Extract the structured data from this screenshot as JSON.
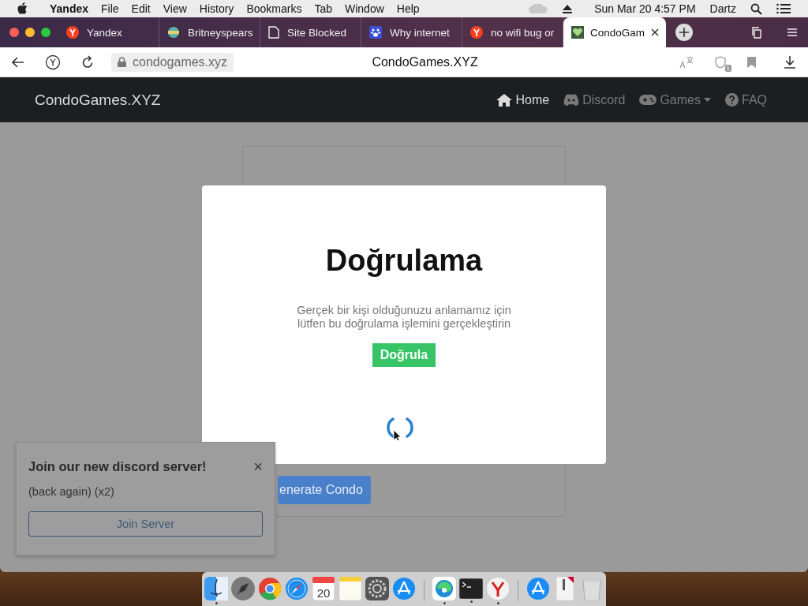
{
  "menubar": {
    "app": "Yandex",
    "menus": [
      "File",
      "Edit",
      "View",
      "History",
      "Bookmarks",
      "Tab",
      "Window",
      "Help"
    ],
    "clock": "Sun Mar 20  4:57 PM",
    "user": "Dartz"
  },
  "tabs": [
    {
      "title": "Yandex",
      "kind": "yandex",
      "selected": false
    },
    {
      "title": "Britneyspears",
      "kind": "globe",
      "selected": false
    },
    {
      "title": "Site Blocked",
      "kind": "page",
      "selected": false
    },
    {
      "title": "Why internet",
      "kind": "paw",
      "selected": false
    },
    {
      "title": "no wifi bug or",
      "kind": "yandex",
      "selected": false
    },
    {
      "title": "CondoGam",
      "kind": "game",
      "selected": true
    }
  ],
  "address_bar": {
    "url": "condogames.xyz",
    "page_title": "CondoGames.XYZ",
    "notification_count": "1"
  },
  "navbar": {
    "brand": "CondoGames.XYZ",
    "links": [
      {
        "label": "Home",
        "kind": "home",
        "selected": true,
        "dropdown": false
      },
      {
        "label": "Discord",
        "kind": "discord",
        "selected": false,
        "dropdown": false
      },
      {
        "label": "Games",
        "kind": "gamepad",
        "selected": false,
        "dropdown": true
      },
      {
        "label": "FAQ",
        "kind": "question",
        "selected": false,
        "dropdown": false
      }
    ]
  },
  "card": {
    "button": "enerate Condo"
  },
  "modal": {
    "title": "Doğrulama",
    "text": "Gerçek bir kişi olduğunuzu anlamamız için\nlütfen bu doğrulama işlemini gerçekleştirin",
    "button": "Doğrula"
  },
  "popup": {
    "title": "Join our new discord server!",
    "close": "×",
    "text": "(back again) (x2)",
    "button": "Join Server"
  },
  "dock": [
    {
      "kind": "finder",
      "running": true
    },
    {
      "kind": "rocket",
      "running": false
    },
    {
      "kind": "chrome",
      "running": false
    },
    {
      "kind": "compass",
      "running": false
    },
    {
      "kind": "calendar",
      "label": "20",
      "running": false
    },
    {
      "kind": "notes",
      "running": false
    },
    {
      "kind": "gear",
      "running": false
    },
    {
      "kind": "store",
      "running": false
    },
    {
      "kind": "separator"
    },
    {
      "kind": "edge",
      "running": true
    },
    {
      "kind": "terminal",
      "running": true
    },
    {
      "kind": "yandex",
      "running": true
    },
    {
      "kind": "separator"
    },
    {
      "kind": "store",
      "running": false
    },
    {
      "kind": "document",
      "running": false
    },
    {
      "kind": "trash",
      "running": false
    }
  ]
}
